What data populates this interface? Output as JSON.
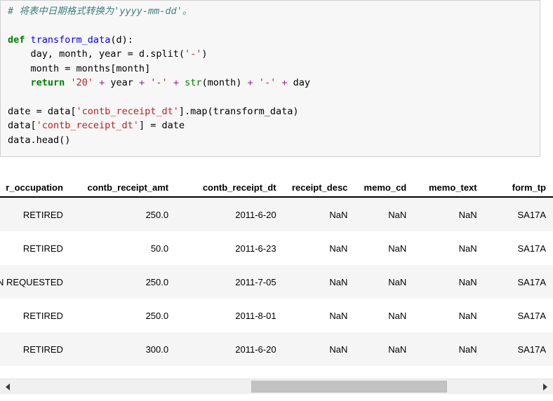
{
  "code_cell": {
    "language": "python",
    "lines": [
      {
        "tokens": [
          {
            "t": "comment",
            "v": "# 将表中日期格式转换为'yyyy-mm-dd'。"
          }
        ]
      },
      {
        "tokens": []
      },
      {
        "tokens": [
          {
            "t": "keyword",
            "v": "def"
          },
          {
            "t": "plain",
            "v": " "
          },
          {
            "t": "function",
            "v": "transform_data"
          },
          {
            "t": "plain",
            "v": "(d):"
          }
        ]
      },
      {
        "tokens": [
          {
            "t": "plain",
            "v": "    day, month, year = d.split("
          },
          {
            "t": "string",
            "v": "'-'"
          },
          {
            "t": "plain",
            "v": ")"
          }
        ]
      },
      {
        "tokens": [
          {
            "t": "plain",
            "v": "    month = months[month]"
          }
        ]
      },
      {
        "tokens": [
          {
            "t": "plain",
            "v": "    "
          },
          {
            "t": "keyword",
            "v": "return"
          },
          {
            "t": "plain",
            "v": " "
          },
          {
            "t": "string",
            "v": "'20'"
          },
          {
            "t": "plain",
            "v": " "
          },
          {
            "t": "operator",
            "v": "+"
          },
          {
            "t": "plain",
            "v": " year "
          },
          {
            "t": "operator",
            "v": "+"
          },
          {
            "t": "plain",
            "v": " "
          },
          {
            "t": "string",
            "v": "'-'"
          },
          {
            "t": "plain",
            "v": " "
          },
          {
            "t": "operator",
            "v": "+"
          },
          {
            "t": "plain",
            "v": " "
          },
          {
            "t": "builtin",
            "v": "str"
          },
          {
            "t": "plain",
            "v": "(month) "
          },
          {
            "t": "operator",
            "v": "+"
          },
          {
            "t": "plain",
            "v": " "
          },
          {
            "t": "string",
            "v": "'-'"
          },
          {
            "t": "plain",
            "v": " "
          },
          {
            "t": "operator",
            "v": "+"
          },
          {
            "t": "plain",
            "v": " day"
          }
        ]
      },
      {
        "tokens": []
      },
      {
        "tokens": [
          {
            "t": "plain",
            "v": "date = data["
          },
          {
            "t": "string",
            "v": "'contb_receipt_dt'"
          },
          {
            "t": "plain",
            "v": "].map(transform_data)"
          }
        ]
      },
      {
        "tokens": [
          {
            "t": "plain",
            "v": "data["
          },
          {
            "t": "string",
            "v": "'contb_receipt_dt'"
          },
          {
            "t": "plain",
            "v": "] = date"
          }
        ]
      },
      {
        "tokens": [
          {
            "t": "plain",
            "v": "data.head()"
          }
        ]
      }
    ],
    "plain_text": "# 将表中日期格式转换为'yyyy-mm-dd'。\n\ndef transform_data(d):\n    day, month, year = d.split('-')\n    month = months[month]\n    return '20' + year + '-' + str(month) + '-' + day\n\ndate = data['contb_receipt_dt'].map(transform_data)\ndata['contb_receipt_dt'] = date\ndata.head()"
  },
  "table": {
    "columns": [
      "r_occupation",
      "contb_receipt_amt",
      "contb_receipt_dt",
      "receipt_desc",
      "memo_cd",
      "memo_text",
      "form_tp"
    ],
    "rows": [
      {
        "occupation": "RETIRED",
        "contb_receipt_amt": "250.0",
        "contb_receipt_dt": "2011-6-20",
        "receipt_desc": "NaN",
        "memo_cd": "NaN",
        "memo_text": "NaN",
        "form_tp": "SA17A"
      },
      {
        "occupation": "RETIRED",
        "contb_receipt_amt": "50.0",
        "contb_receipt_dt": "2011-6-23",
        "receipt_desc": "NaN",
        "memo_cd": "NaN",
        "memo_text": "NaN",
        "form_tp": "SA17A"
      },
      {
        "occupation": "INFORMATION REQUESTED",
        "contb_receipt_amt": "250.0",
        "contb_receipt_dt": "2011-7-05",
        "receipt_desc": "NaN",
        "memo_cd": "NaN",
        "memo_text": "NaN",
        "form_tp": "SA17A"
      },
      {
        "occupation": "RETIRED",
        "contb_receipt_amt": "250.0",
        "contb_receipt_dt": "2011-8-01",
        "receipt_desc": "NaN",
        "memo_cd": "NaN",
        "memo_text": "NaN",
        "form_tp": "SA17A"
      },
      {
        "occupation": "RETIRED",
        "contb_receipt_amt": "300.0",
        "contb_receipt_dt": "2011-6-20",
        "receipt_desc": "NaN",
        "memo_cd": "NaN",
        "memo_text": "NaN",
        "form_tp": "SA17A"
      }
    ]
  },
  "scrollbar": {
    "left_arrow": "◀",
    "right_arrow": "▶",
    "orientation": "horizontal"
  },
  "colors": {
    "code_background": "#f7f7f7",
    "code_border": "#cfcfcf",
    "comment": "#408080",
    "keyword": "#008000",
    "function_name": "#0000ff",
    "string": "#ba2121",
    "operator": "#a020a0",
    "builtin": "#008000",
    "row_odd": "#f5f5f5",
    "row_even": "#ffffff",
    "header_rule": "#000000",
    "scroll_thumb": "#c2c2c2",
    "scroll_track": "#f0f0f0"
  }
}
